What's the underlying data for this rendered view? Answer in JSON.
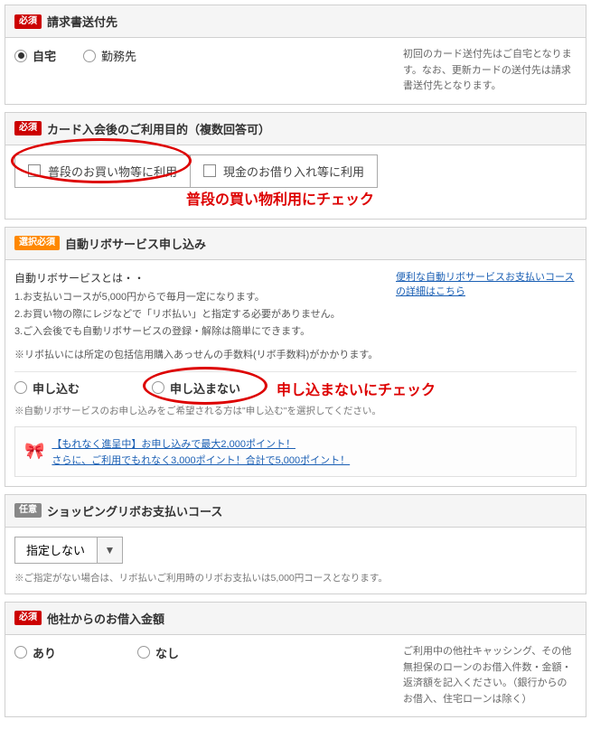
{
  "section_billing": {
    "badge": "必須",
    "title": "請求書送付先",
    "option_home": "自宅",
    "option_work": "勤務先",
    "help": "初回のカード送付先はご自宅となります。なお、更新カードの送付先は請求書送付先となります。"
  },
  "section_purpose": {
    "badge": "必須",
    "title": "カード入会後のご利用目的（複数回答可）",
    "check1": "普段のお買い物等に利用",
    "check2": "現金のお借り入れ等に利用",
    "annotation": "普段の買い物利用にチェック"
  },
  "section_revo": {
    "badge": "選択必須",
    "title": "自動リボサービス申し込み",
    "info_title": "自動リボサービスとは・・",
    "info1": "1.お支払いコースが5,000円からで毎月一定になります。",
    "info2": "2.お買い物の際にレジなどで「リボ払い」と指定する必要がありません。",
    "info3": "3.ご入会後でも自動リボサービスの登録・解除は簡単にできます。",
    "info_note": "※リボ払いには所定の包括信用購入あっせんの手数料(リボ手数料)がかかります。",
    "detail_link": "便利な自動リボサービスお支払いコースの詳細はこちら",
    "option_apply": "申し込む",
    "option_noapply": "申し込まない",
    "annotation": "申し込まないにチェック",
    "note": "※自動リボサービスのお申し込みをご希望される方は\"申し込む\"を選択してください。",
    "promo1": "【もれなく進呈中】お申し込みで最大2,000ポイント！",
    "promo2": "さらに、ご利用でもれなく3,000ポイント！合計で5,000ポイント！"
  },
  "section_course": {
    "badge": "任意",
    "title": "ショッピングリボお支払いコース",
    "select_value": "指定しない",
    "note": "※ご指定がない場合は、リボ払いご利用時のリボお支払いは5,000円コースとなります。"
  },
  "section_other": {
    "badge": "必須",
    "title": "他社からのお借入金額",
    "option_yes": "あり",
    "option_no": "なし",
    "help": "ご利用中の他社キャッシング、その他無担保のローンのお借入件数・金額・返済額を記入ください。（銀行からのお借入、住宅ローンは除く）"
  }
}
